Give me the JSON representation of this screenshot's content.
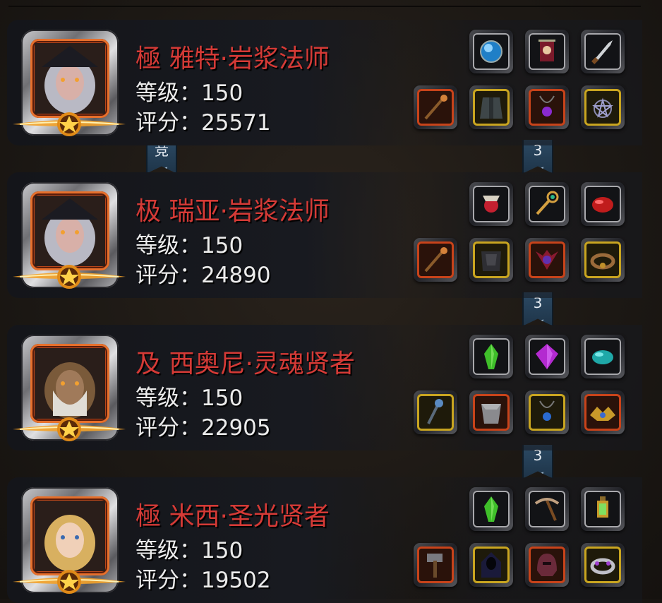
{
  "characters": [
    {
      "name": "極 雅特·岩浆法师",
      "level_text": "等级：150",
      "score_text": "评分：25571",
      "avatar": "witch-portrait-icon",
      "equipment": [
        {
          "icon": "crystal-orb-icon",
          "rarity": "white"
        },
        {
          "icon": "banner-icon",
          "rarity": "white"
        },
        {
          "icon": "dagger-icon",
          "rarity": "white"
        },
        {
          "icon": "staff-icon",
          "rarity": "orange"
        },
        {
          "icon": "robe-icon",
          "rarity": "gold"
        },
        {
          "icon": "amulet-icon",
          "rarity": "orange"
        },
        {
          "icon": "pentagram-amulet-icon",
          "rarity": "gold"
        }
      ]
    },
    {
      "name": "极 瑞亚·岩浆法师",
      "level_text": "等级：150",
      "score_text": "评分：24890",
      "avatar": "witch-portrait-icon",
      "equipment": [
        {
          "icon": "skull-orb-icon",
          "rarity": "white"
        },
        {
          "icon": "key-icon",
          "rarity": "white"
        },
        {
          "icon": "red-gem-icon",
          "rarity": "white"
        },
        {
          "icon": "staff-icon",
          "rarity": "orange"
        },
        {
          "icon": "dark-armor-icon",
          "rarity": "gold"
        },
        {
          "icon": "demon-charm-icon",
          "rarity": "orange"
        },
        {
          "icon": "bracelet-icon",
          "rarity": "gold"
        }
      ]
    },
    {
      "name": "及 西奥尼·灵魂贤者",
      "level_text": "等级：150",
      "score_text": "评分：22905",
      "avatar": "druid-portrait-icon",
      "equipment": [
        {
          "icon": "green-crystal-icon",
          "rarity": "white"
        },
        {
          "icon": "purple-gem-icon",
          "rarity": "white"
        },
        {
          "icon": "teal-gem-icon",
          "rarity": "white"
        },
        {
          "icon": "serpent-staff-icon",
          "rarity": "gold"
        },
        {
          "icon": "plate-armor-icon",
          "rarity": "orange"
        },
        {
          "icon": "blue-amulet-icon",
          "rarity": "gold"
        },
        {
          "icon": "winged-crown-icon",
          "rarity": "orange"
        }
      ]
    },
    {
      "name": "極 米西·圣光贤者",
      "level_text": "等级：150",
      "score_text": "评分：19502",
      "avatar": "priestess-portrait-icon",
      "equipment": [
        {
          "icon": "green-crystal-icon",
          "rarity": "white"
        },
        {
          "icon": "pickaxe-icon",
          "rarity": "white"
        },
        {
          "icon": "lantern-icon",
          "rarity": "white"
        },
        {
          "icon": "hammer-icon",
          "rarity": "orange"
        },
        {
          "icon": "hooded-robe-icon",
          "rarity": "gold"
        },
        {
          "icon": "helm-icon",
          "rarity": "orange"
        },
        {
          "icon": "gem-ring-icon",
          "rarity": "gold"
        }
      ]
    }
  ],
  "ribbons": [
    {
      "label": "竞"
    },
    {
      "label": "3"
    },
    {
      "label": "3"
    },
    {
      "label": "3"
    }
  ],
  "colors": {
    "name_red": "#d53a36",
    "stat_white": "#ececec",
    "rarity_orange": "#c8431a",
    "rarity_gold": "#c9a520",
    "rarity_white": "#a8a8ac",
    "ribbon_blue": "#2c4a64"
  }
}
